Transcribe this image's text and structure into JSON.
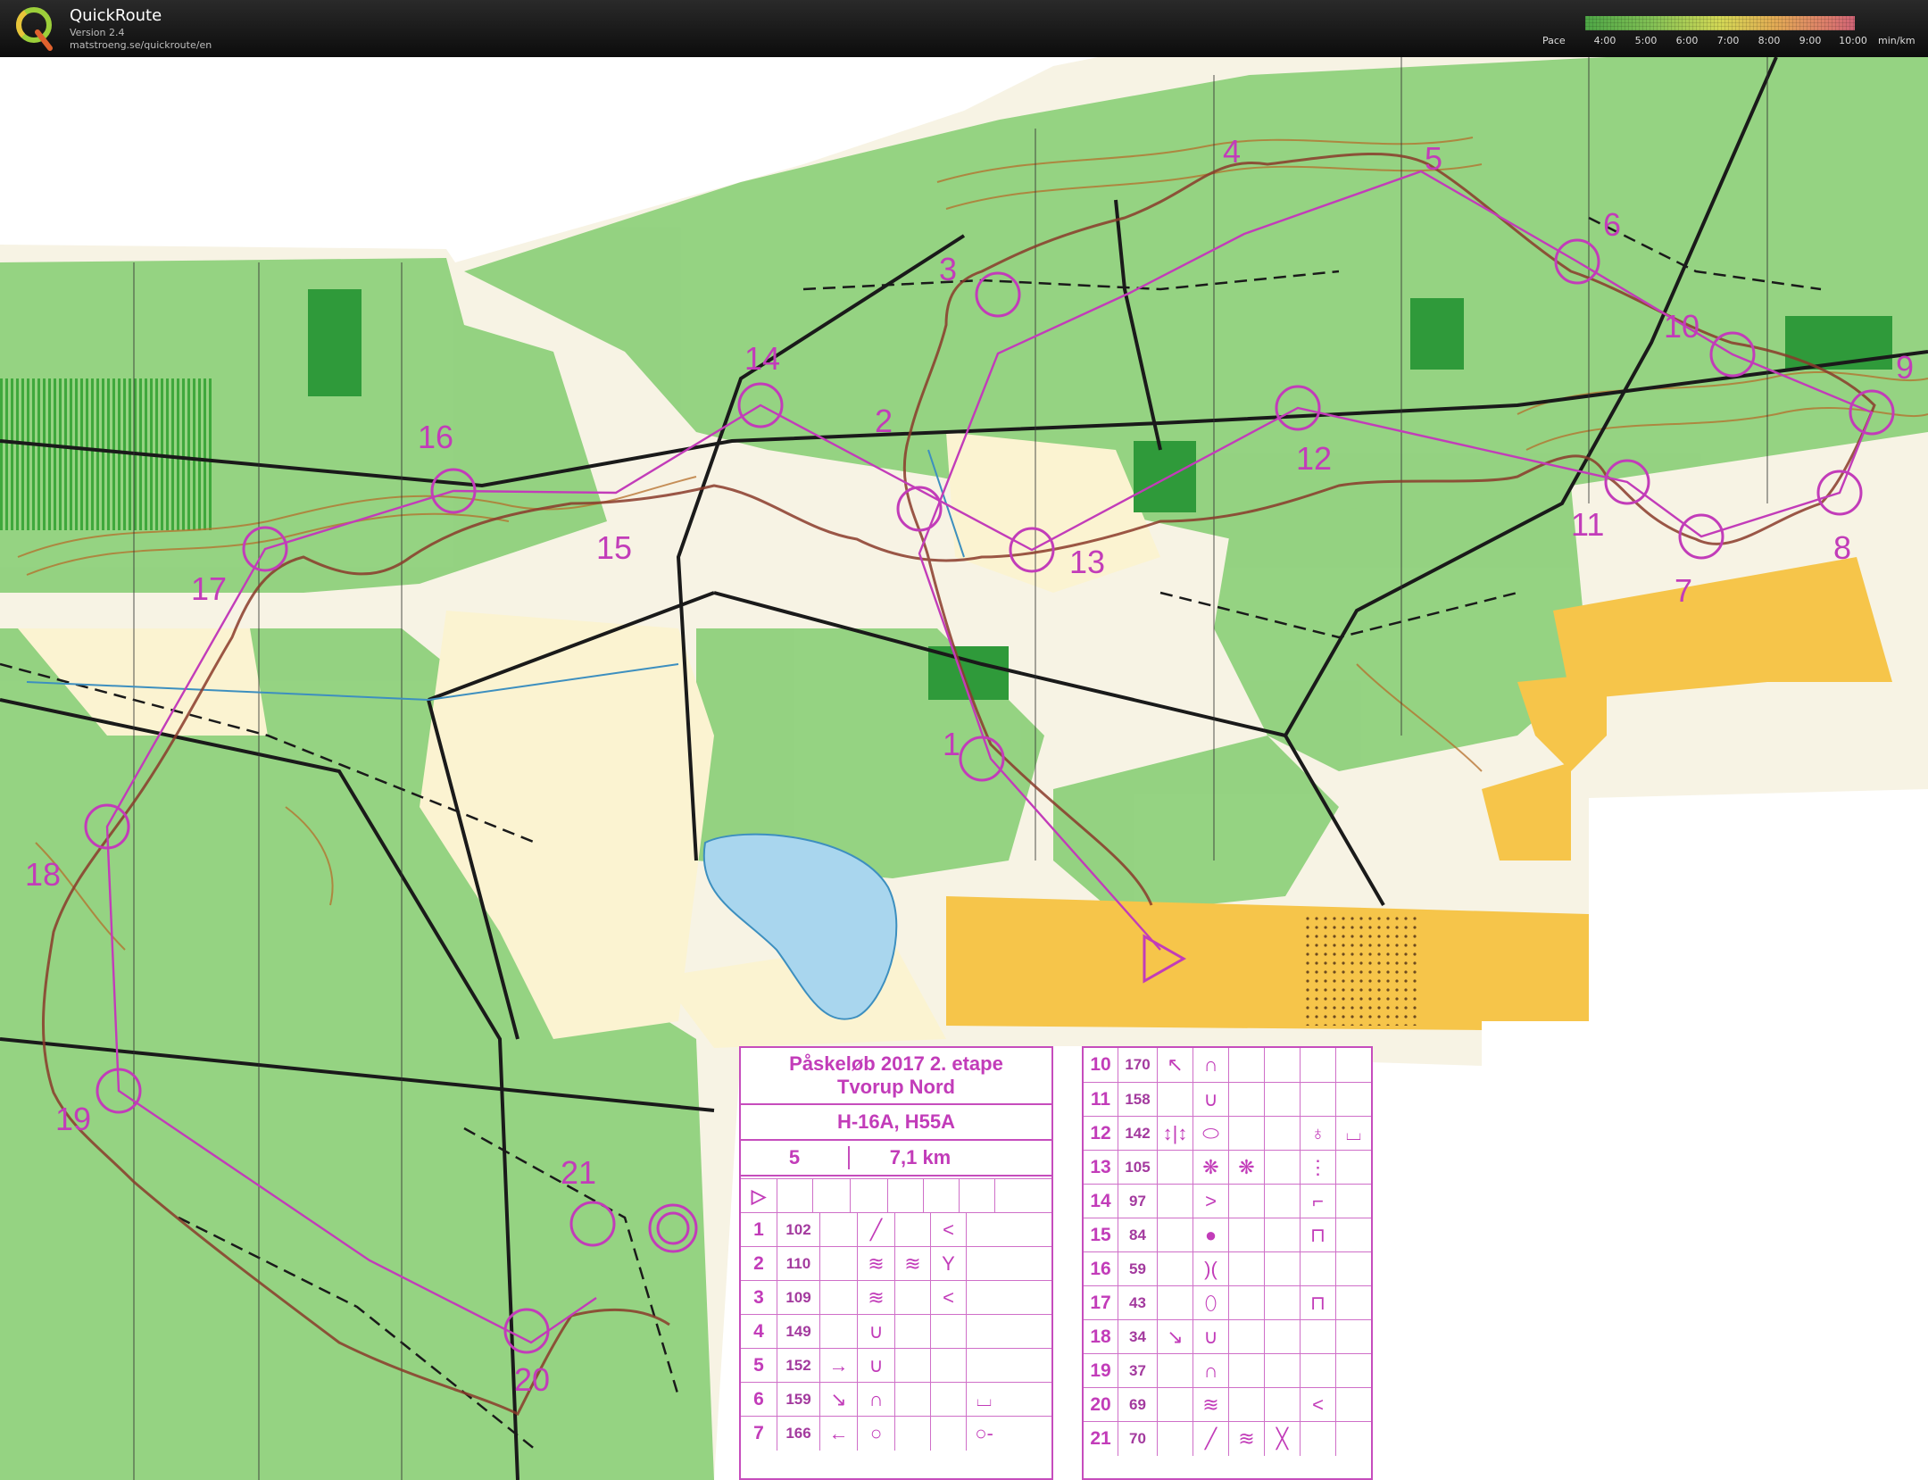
{
  "app": {
    "title": "QuickRoute",
    "version": "Version 2.4",
    "url": "matstroeng.se/quickroute/en"
  },
  "pace_legend": {
    "label": "Pace",
    "ticks": [
      "4:00",
      "5:00",
      "6:00",
      "7:00",
      "8:00",
      "9:00",
      "10:00"
    ],
    "unit": "min/km",
    "colors": {
      "fast": "#52b24a",
      "mid": "#e3e85a",
      "slow": "#e06a7e"
    }
  },
  "map": {
    "course_color": "#c23cb9",
    "route_color": "#8a3a2a",
    "lake_color": "#a9d6ee",
    "forest_color": "#8fd17c",
    "open_color": "#f6c54a",
    "control_labels": [
      "1",
      "2",
      "3",
      "4",
      "5",
      "6",
      "7",
      "8",
      "9",
      "10",
      "11",
      "12",
      "13",
      "14",
      "15",
      "16",
      "17",
      "18",
      "19",
      "20",
      "21"
    ]
  },
  "card": {
    "title": "Påskeløb 2017 2. etape",
    "subtitle": "Tvorup Nord",
    "classes": "H-16A, H55A",
    "course_number": "5",
    "length": "7,1 km",
    "start_symbol": "▷",
    "left_rows": [
      {
        "num": "1",
        "code": "102"
      },
      {
        "num": "2",
        "code": "110"
      },
      {
        "num": "3",
        "code": "109"
      },
      {
        "num": "4",
        "code": "149"
      },
      {
        "num": "5",
        "code": "152"
      },
      {
        "num": "6",
        "code": "159"
      },
      {
        "num": "7",
        "code": "166"
      }
    ],
    "right_rows": [
      {
        "num": "10",
        "code": "170"
      },
      {
        "num": "11",
        "code": "158"
      },
      {
        "num": "12",
        "code": "142"
      },
      {
        "num": "13",
        "code": "105"
      },
      {
        "num": "14",
        "code": "97"
      },
      {
        "num": "15",
        "code": "84"
      },
      {
        "num": "16",
        "code": "59"
      },
      {
        "num": "17",
        "code": "43"
      },
      {
        "num": "18",
        "code": "34"
      },
      {
        "num": "19",
        "code": "37"
      },
      {
        "num": "20",
        "code": "69"
      },
      {
        "num": "21",
        "code": "70"
      }
    ]
  }
}
